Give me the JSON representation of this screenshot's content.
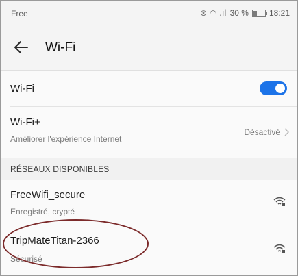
{
  "status_bar": {
    "carrier": "Free",
    "signal_text": "⊗ ◠ .ıl",
    "battery_percent": "30 %",
    "battery_level": 0.3,
    "time": "18:21"
  },
  "app_bar": {
    "back_icon": "back-arrow-icon",
    "title": "Wi-Fi"
  },
  "wifi_toggle": {
    "label": "Wi-Fi",
    "enabled": true,
    "accent": "#1c73e8"
  },
  "wifi_plus": {
    "label": "Wi-Fi+",
    "sublabel": "Améliorer l'expérience Internet",
    "status": "Désactivé"
  },
  "available_networks": {
    "header": "RÉSEAUX DISPONIBLES",
    "items": [
      {
        "ssid": "FreeWifi_secure",
        "detail": "Enregistré, crypté",
        "icon": "wifi-secure-icon"
      },
      {
        "ssid": "TripMateTitan-2366",
        "detail": "Sécurisé",
        "icon": "wifi-secure-icon"
      }
    ]
  },
  "annotation": {
    "color": "#7c2b2b"
  }
}
